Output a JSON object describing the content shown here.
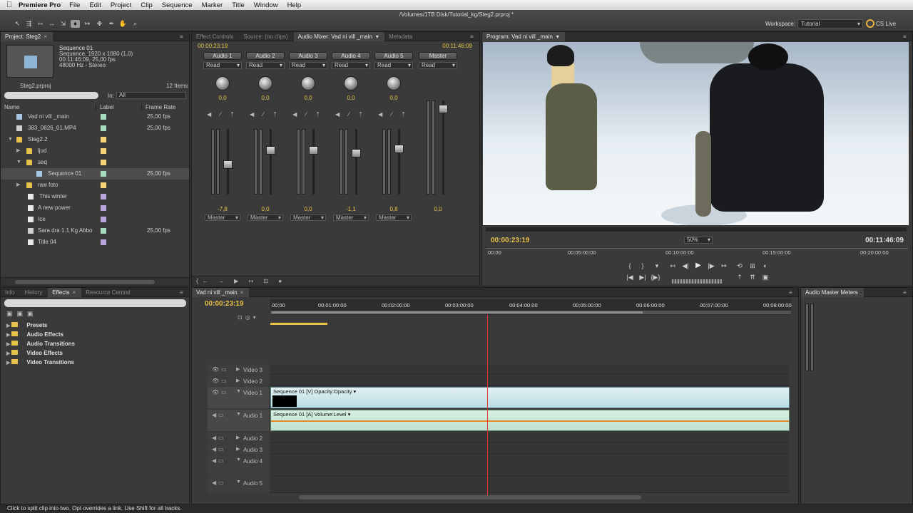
{
  "menubar": {
    "app_name": "Premiere Pro",
    "items": [
      "File",
      "Edit",
      "Project",
      "Clip",
      "Sequence",
      "Marker",
      "Title",
      "Window",
      "Help"
    ]
  },
  "toolbar": {
    "doc_path": "/Volumes/1TB Disk/Tutorial_kg/Steg2.prproj *",
    "workspace_label": "Workspace:",
    "workspace_value": "Tutorial",
    "cslive": "CS Live"
  },
  "project": {
    "tab": "Project: Steg2",
    "seq_name": "Sequence 01",
    "seq_lines": [
      "Sequence, 1920 x 1080 (1,0)",
      "00:11:46:09, 25,00 fps",
      "48000 Hz - Stereo"
    ],
    "file": "Steg2.prproj",
    "count": "12 Items",
    "in_label": "In:",
    "in_value": "All",
    "columns": {
      "name": "Name",
      "label": "Label",
      "fps": "Frame Rate"
    },
    "rows": [
      {
        "name": "Vad ni vill _main",
        "fps": "25,00 fps",
        "icon": "seq",
        "label_color": "#a9d9c0"
      },
      {
        "name": "383_0626_01.MP4",
        "fps": "25,00 fps",
        "icon": "clip",
        "label_color": "#a9d9c0"
      },
      {
        "name": "Steg2.2",
        "fps": "",
        "icon": "bin",
        "label_color": "#f3d27a"
      },
      {
        "name": "ljud",
        "fps": "",
        "icon": "bin",
        "label_color": "#f3d27a"
      },
      {
        "name": "seq",
        "fps": "",
        "icon": "bin",
        "label_color": "#f3d27a"
      },
      {
        "name": "Sequence 01",
        "fps": "25,00 fps",
        "icon": "seq",
        "label_color": "#a9d9c0"
      },
      {
        "name": "raw foto",
        "fps": "",
        "icon": "bin",
        "label_color": "#f3d27a"
      },
      {
        "name": "This winter",
        "fps": "",
        "icon": "title",
        "label_color": "#b7a7d9"
      },
      {
        "name": "A new power",
        "fps": "",
        "icon": "title",
        "label_color": "#b7a7d9"
      },
      {
        "name": "Ice",
        "fps": "",
        "icon": "title",
        "label_color": "#b7a7d9"
      },
      {
        "name": "Sara dra 1.1 Kg Abbo",
        "fps": "25,00 fps",
        "icon": "clip",
        "label_color": "#a9d9c0"
      },
      {
        "name": "Title 04",
        "fps": "",
        "icon": "title",
        "label_color": "#b7a7d9"
      }
    ]
  },
  "mixer": {
    "tabs": [
      "Effect Controls",
      "Source: (no clips)",
      "Audio Mixer: Vad ni vill _main",
      "Metadata"
    ],
    "tc_left": "00:00:23:19",
    "tc_right": "00:11:46:09",
    "mode": "Read",
    "output": "Master",
    "channels": [
      {
        "name": "Audio 1",
        "pan": "0,0",
        "vol": "-7,8",
        "fader": 0.55
      },
      {
        "name": "Audio 2",
        "pan": "0,0",
        "vol": "0,0",
        "fader": 0.3
      },
      {
        "name": "Audio 3",
        "pan": "0,0",
        "vol": "0,0",
        "fader": 0.3
      },
      {
        "name": "Audio 4",
        "pan": "0,0",
        "vol": "-1,1",
        "fader": 0.35
      },
      {
        "name": "Audio 5",
        "pan": "0,0",
        "vol": "0,8",
        "fader": 0.28
      },
      {
        "name": "Master",
        "pan": "",
        "vol": "0,0",
        "fader": 0.05
      }
    ]
  },
  "program": {
    "tab": "Program: Vad ni vill _main",
    "tc_left": "00:00:23:19",
    "tc_right": "00:11:46:09",
    "zoom": "50%",
    "ruler": [
      "00:00",
      "00:05:00:00",
      "00:10:00:00",
      "00:15:00:00",
      "00:20:00:00"
    ]
  },
  "effects": {
    "tabs": [
      "Info",
      "History",
      "Effects",
      "Resource Central"
    ],
    "folders": [
      "Presets",
      "Audio Effects",
      "Audio Transitions",
      "Video Effects",
      "Video Transitions"
    ]
  },
  "timeline": {
    "tab": "Vad ni vill _main",
    "tc": "00:00:23:19",
    "ruler": [
      "00:00",
      "00:01:00:00",
      "00:02:00:00",
      "00:03:00:00",
      "00:04:00:00",
      "00:05:00:00",
      "00:06:00:00",
      "00:07:00:00",
      "00:08:00:00"
    ],
    "tracks": {
      "video3": "Video 3",
      "video2": "Video 2",
      "video1": "Video 1",
      "audio1": "Audio 1",
      "audio2": "Audio 2",
      "audio3": "Audio 3",
      "audio4": "Audio 4",
      "audio5": "Audio 5"
    },
    "video_clip": "Sequence 01 [V] Opacity:Opacity ▾",
    "audio_clip": "Sequence 01 [A] Volume:Level ▾"
  },
  "meters": {
    "tab": "Audio Master Meters"
  },
  "status": "Click to split clip into two. Opt overrides a link. Use Shift for all tracks."
}
